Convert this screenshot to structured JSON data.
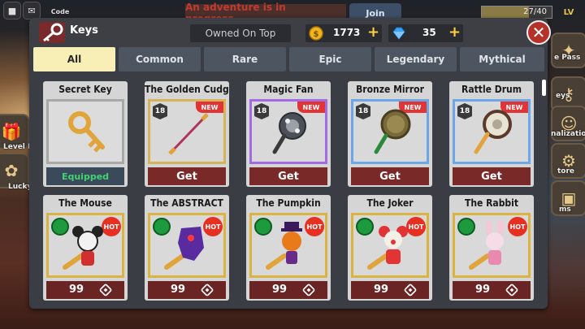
{
  "topbar": {
    "menu_icon": "roblox-icon",
    "chat_icon": "chat-icon",
    "code_label": "Code",
    "adventure_text": "An adventure is in progress...",
    "join_label": "Join",
    "level_progress_text": "27/40",
    "level_progress_fraction": 0.675,
    "level_badge": "LV"
  },
  "side_left": [
    {
      "label": "Level Re",
      "icon": "gift-icon"
    },
    {
      "label": "Lucky",
      "icon": "clover-icon"
    }
  ],
  "side_right": [
    {
      "label": "e Pass",
      "icon": "pass-icon"
    },
    {
      "label": "eys",
      "icon": "key-icon"
    },
    {
      "label": "nalization",
      "icon": "person-icon"
    },
    {
      "label": "tore",
      "icon": "gear-icon"
    },
    {
      "label": "ms",
      "icon": "box-icon"
    }
  ],
  "panel": {
    "title": "Keys",
    "sort_label": "Owned On Top",
    "coins": "1773",
    "gems": "35",
    "close_icon": "close-icon"
  },
  "tabs": [
    "All",
    "Common",
    "Rare",
    "Epic",
    "Legendary",
    "Mythical"
  ],
  "active_tab": "All",
  "keys_row1": [
    {
      "name": "Secret Key",
      "rarity": "common",
      "age": "",
      "new": "",
      "action": "Equipped",
      "art": "golden-key"
    },
    {
      "name": "The Golden Cudgel",
      "rarity": "rare",
      "age": "18",
      "new": "NEW",
      "action": "Get",
      "art": "staff"
    },
    {
      "name": "Magic Fan",
      "rarity": "epic",
      "age": "18",
      "new": "NEW",
      "action": "Get",
      "art": "fan"
    },
    {
      "name": "Bronze Mirror",
      "rarity": "legendary",
      "age": "18",
      "new": "NEW",
      "action": "Get",
      "art": "mirror"
    },
    {
      "name": "Rattle Drum",
      "rarity": "legendary",
      "age": "18",
      "new": "NEW",
      "action": "Get",
      "art": "drum"
    }
  ],
  "keys_row2": [
    {
      "name": "The Mouse",
      "hot": "HOT",
      "price": "99",
      "art": "mouse"
    },
    {
      "name": "The ABSTRACT",
      "hot": "HOT",
      "price": "99",
      "art": "abstract"
    },
    {
      "name": "The Pumpkin",
      "hot": "HOT",
      "price": "99",
      "art": "pumpkin"
    },
    {
      "name": "The Joker",
      "hot": "HOT",
      "price": "99",
      "art": "joker"
    },
    {
      "name": "The Rabbit",
      "hot": "HOT",
      "price": "99",
      "art": "rabbit"
    }
  ],
  "colors": {
    "tab_active": "#f7efb6",
    "action_red": "#7a2929",
    "equipped_green": "#3fd46f",
    "new_red": "#e23434",
    "coin_gold": "#f2b51b",
    "gem_blue": "#3aa3f5"
  }
}
